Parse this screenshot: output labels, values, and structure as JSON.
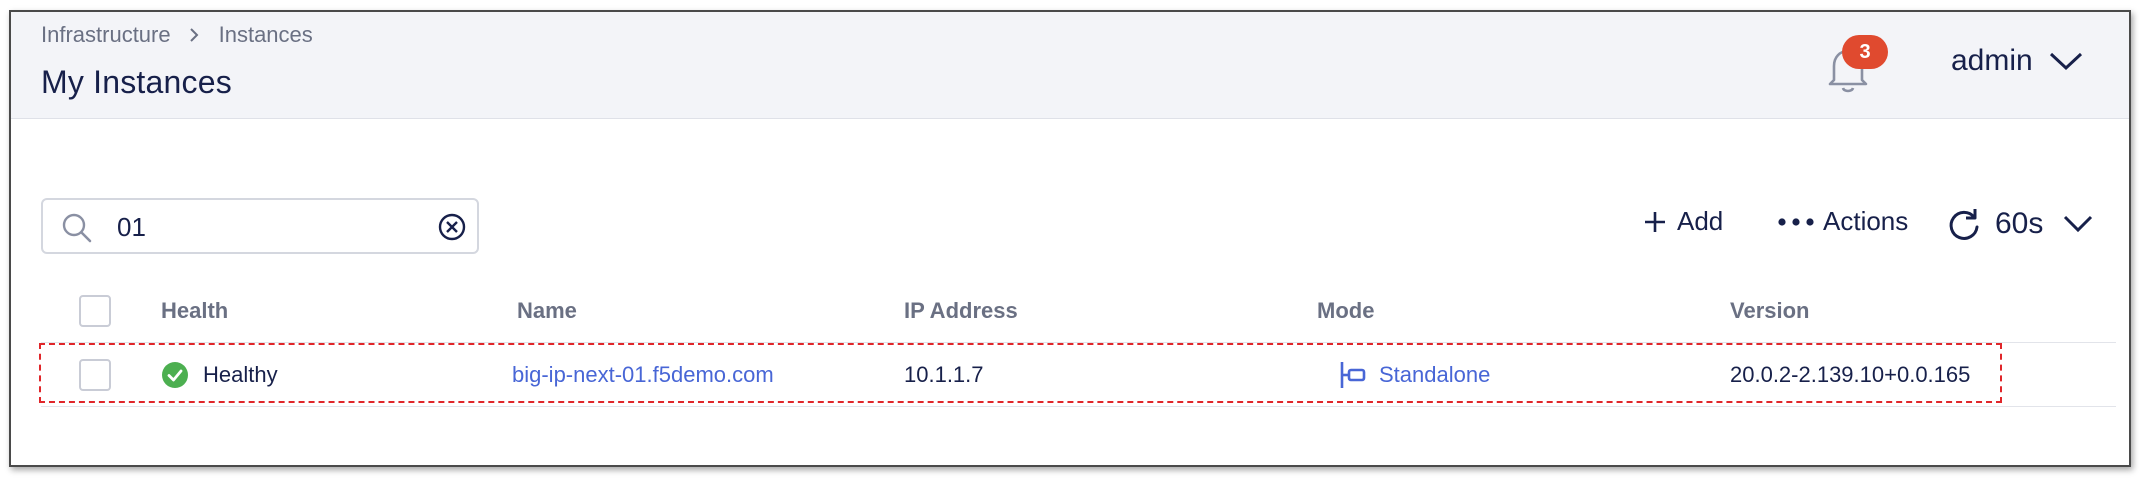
{
  "breadcrumb": {
    "items": [
      "Infrastructure",
      "Instances"
    ]
  },
  "header": {
    "title": "My Instances",
    "notifications_count": "3",
    "user": "admin"
  },
  "search": {
    "value": "01"
  },
  "toolbar": {
    "add_label": "Add",
    "actions_label": "Actions",
    "refresh_interval": "60s"
  },
  "table": {
    "columns": [
      "Health",
      "Name",
      "IP Address",
      "Mode",
      "Version"
    ],
    "rows": [
      {
        "health": "Healthy",
        "name": "big-ip-next-01.f5demo.com",
        "ip": "10.1.1.7",
        "mode": "Standalone",
        "version": "20.0.2-2.139.10+0.0.165"
      }
    ]
  },
  "colors": {
    "accent": "#4866d6",
    "healthy": "#4caf50",
    "badge": "#e04a2f",
    "highlight": "#e0262a"
  },
  "icons": [
    "chevron-right-icon",
    "bell-icon",
    "chevron-down-icon",
    "search-icon",
    "clear-circle-x-icon",
    "plus-icon",
    "more-dots-icon",
    "refresh-icon",
    "check-circle-icon",
    "standalone-mode-icon"
  ]
}
